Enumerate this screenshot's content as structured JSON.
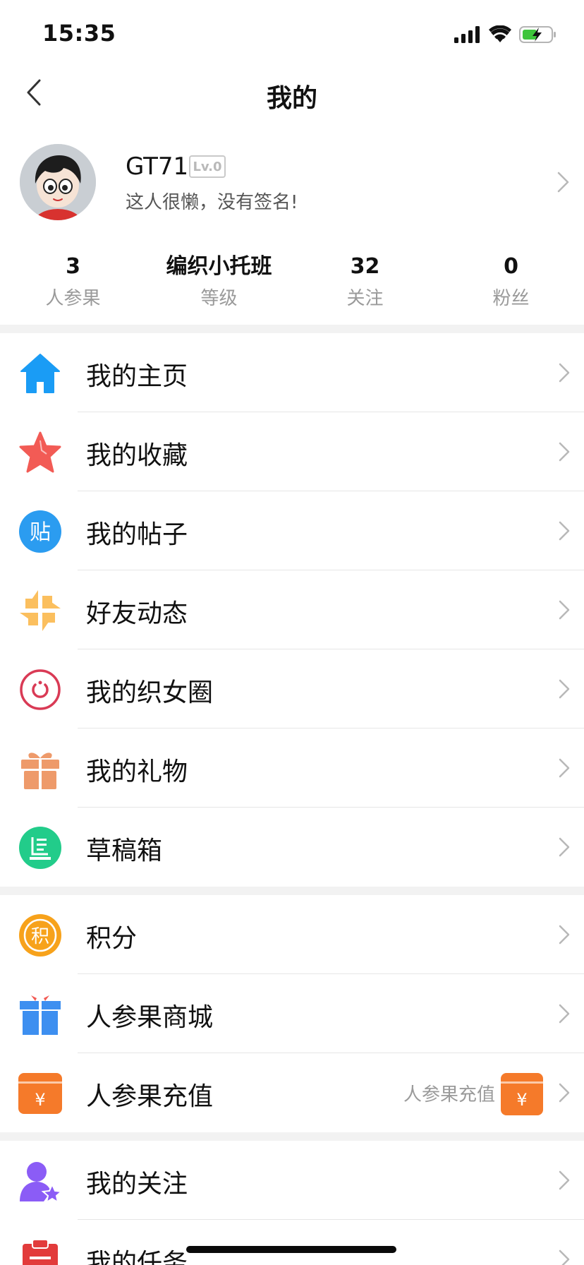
{
  "status_bar": {
    "time": "15:35"
  },
  "nav": {
    "title": "我的"
  },
  "profile": {
    "username": "GT71",
    "level": "Lv.0",
    "signature": "这人很懒，没有签名!"
  },
  "stats": [
    {
      "value": "3",
      "label": "人参果"
    },
    {
      "value": "编织小托班",
      "label": "等级"
    },
    {
      "value": "32",
      "label": "关注"
    },
    {
      "value": "0",
      "label": "粉丝"
    }
  ],
  "menu": {
    "group1": [
      {
        "label": "我的主页",
        "icon": "home-icon",
        "color": "#1a9cf5"
      },
      {
        "label": "我的收藏",
        "icon": "star-icon",
        "color": "#f25b55"
      },
      {
        "label": "我的帖子",
        "icon": "post-icon",
        "color": "#2b9cf0",
        "glyph": "贴"
      },
      {
        "label": "好友动态",
        "icon": "pinwheel-icon",
        "color": "#fbbf5e"
      },
      {
        "label": "我的织女圈",
        "icon": "circle-icon",
        "color": "#d93a55"
      },
      {
        "label": "我的礼物",
        "icon": "gift-icon",
        "color": "#ee9a6a"
      },
      {
        "label": "草稿箱",
        "icon": "draft-box-icon",
        "color": "#22cc8a"
      }
    ],
    "group2": [
      {
        "label": "积分",
        "icon": "points-icon",
        "color": "#f7a21b",
        "glyph": "积"
      },
      {
        "label": "人参果商城",
        "icon": "shop-gift-icon",
        "color": "#3d8ff0"
      },
      {
        "label": "人参果充值",
        "icon": "recharge-icon",
        "color": "#f57a2a",
        "extra": "人参果充值",
        "glyph": "¥"
      }
    ],
    "group3": [
      {
        "label": "我的关注",
        "icon": "follow-user-icon",
        "color": "#8b5cf6"
      },
      {
        "label": "我的任务",
        "icon": "task-clipboard-icon",
        "color": "#e23b3b"
      }
    ]
  }
}
